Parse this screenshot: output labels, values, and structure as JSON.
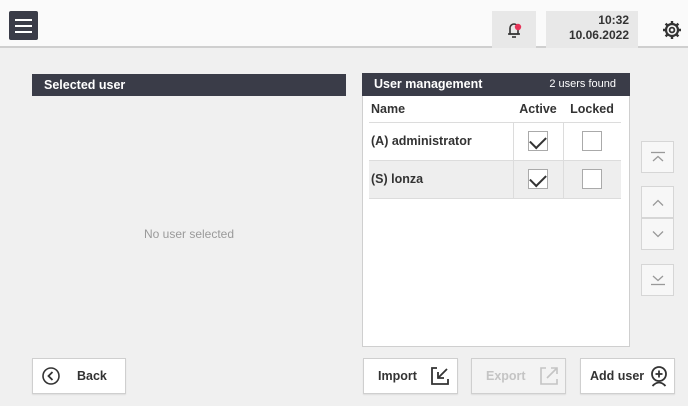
{
  "header": {
    "time": "10:32",
    "date": "10.06.2022",
    "menu_icon": "hamburger-menu-icon",
    "bell_icon": "bell-icon",
    "settings_icon": "settings-icon",
    "accent_color": "#e6355a"
  },
  "selected_user_panel": {
    "title": "Selected user",
    "empty_text": "No user selected"
  },
  "user_management": {
    "title": "User management",
    "count_text": "2 users found",
    "columns": [
      "Name",
      "Active",
      "Locked"
    ],
    "rows": [
      {
        "name": "(A) administrator",
        "active": true,
        "locked": false
      },
      {
        "name": "(S) lonza",
        "active": true,
        "locked": false
      }
    ]
  },
  "footer": {
    "back_label": "Back",
    "import_label": "Import",
    "export_label": "Export",
    "add_user_label": "Add user"
  },
  "colors": {
    "header_bar": "#3a3c48",
    "background": "#f0f0f0"
  }
}
